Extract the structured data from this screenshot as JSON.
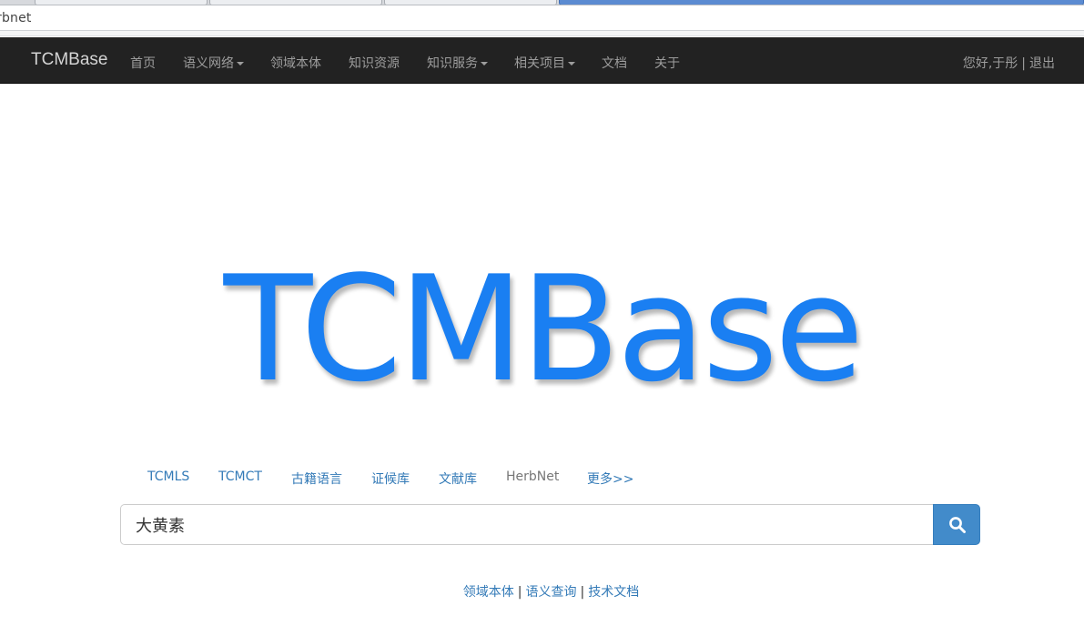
{
  "browser": {
    "url": "rbnet"
  },
  "navbar": {
    "brand": "TCMBase",
    "items": [
      {
        "label": "首页",
        "dropdown": false
      },
      {
        "label": "语义网络",
        "dropdown": true
      },
      {
        "label": "领域本体",
        "dropdown": false
      },
      {
        "label": "知识资源",
        "dropdown": false
      },
      {
        "label": "知识服务",
        "dropdown": true
      },
      {
        "label": "相关项目",
        "dropdown": true
      },
      {
        "label": "文档",
        "dropdown": false
      },
      {
        "label": "关于",
        "dropdown": false
      }
    ],
    "greeting": "您好,于彤",
    "separator": "|",
    "logout": "退出"
  },
  "logo": {
    "text": "TCMBase",
    "color": "#1a7ff2"
  },
  "sources": {
    "items": [
      "TCMLS",
      "TCMCT",
      "古籍语言",
      "证候库",
      "文献库",
      "HerbNet",
      "更多>>"
    ],
    "active": "HerbNet"
  },
  "search": {
    "value": "大黄素",
    "button_icon": "search-icon",
    "button_color": "#428bca"
  },
  "footer": {
    "links": [
      "领域本体",
      "语义查询",
      "技术文档"
    ],
    "separator": "|"
  }
}
